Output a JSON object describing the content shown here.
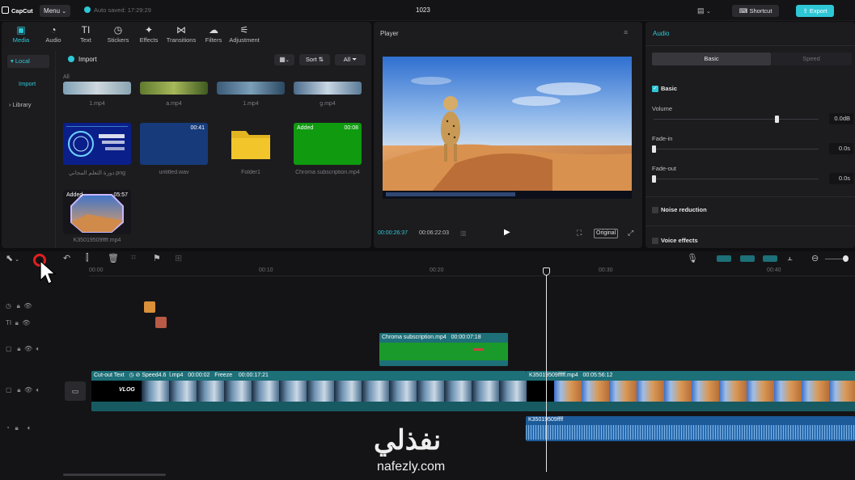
{
  "app": {
    "name": "CapCut",
    "menu_label": "Menu",
    "autosave": "Auto saved: 17:29:29",
    "project_title": "1023",
    "shortcut_label": "Shortcut",
    "export_label": "Export"
  },
  "media_tabs": [
    {
      "label": "Media",
      "icon": "media-icon"
    },
    {
      "label": "Audio",
      "icon": "audio-icon"
    },
    {
      "label": "Text",
      "icon": "text-icon"
    },
    {
      "label": "Stickers",
      "icon": "stickers-icon"
    },
    {
      "label": "Effects",
      "icon": "effects-icon"
    },
    {
      "label": "Transitions",
      "icon": "transitions-icon"
    },
    {
      "label": "Filters",
      "icon": "filters-icon"
    },
    {
      "label": "Adjustment",
      "icon": "adjustment-icon"
    }
  ],
  "sidebar": {
    "local": "Local",
    "import": "Import",
    "library": "Library"
  },
  "media_panel": {
    "import_label": "Import",
    "sort_label": "Sort",
    "all_label": "All",
    "section_label": "All",
    "row1": [
      {
        "name": "1.mp4"
      },
      {
        "name": "a.mp4"
      },
      {
        "name": "1.mp4"
      },
      {
        "name": "g.mp4"
      }
    ],
    "row2": [
      {
        "name": "دورة التعلم المجاني.png"
      },
      {
        "name": "untitled.wav",
        "duration": "00:41"
      },
      {
        "name": "Folder1"
      },
      {
        "name": "Chroma subscription.mp4",
        "duration": "00:08",
        "badge": "Added"
      }
    ],
    "row3": [
      {
        "name": "K35019509ffff.mp4",
        "duration": "05:57",
        "badge": "Added"
      }
    ]
  },
  "player": {
    "title": "Player",
    "current_time": "00:00:26:37",
    "total_time": "00:06:22:03",
    "original_label": "Original"
  },
  "inspector": {
    "title": "Audio",
    "tab_basic": "Basic",
    "tab_speed": "Speed",
    "basic_label": "Basic",
    "volume_label": "Volume",
    "volume_value": "0.0dB",
    "fadein_label": "Fade-in",
    "fadein_value": "0.0s",
    "fadeout_label": "Fade-out",
    "fadeout_value": "0.0s",
    "noise_label": "Noise reduction",
    "voice_label": "Voice effects"
  },
  "timeline": {
    "ruler": [
      "00:00",
      "00:10",
      "00:20",
      "00:30",
      "00:40"
    ],
    "chroma_clip": {
      "name": "Chroma subscription.mp4",
      "duration": "00:00:07:18"
    },
    "main_clip": {
      "cutout": "Cut-out Text",
      "speed": "Speed4.6",
      "file": "l.mp4",
      "time1": "00:00:02",
      "freeze": "Freeze",
      "time2": "00:00:17:21",
      "vlog": "VLOG"
    },
    "second_clip": {
      "name": "K35019509fffff.mp4",
      "duration": "00:05:56:12"
    },
    "audio_clip": {
      "name": "K35019509ffff"
    }
  },
  "watermark": {
    "arabic": "نفذلي",
    "latin": "nafezly.com"
  },
  "colors": {
    "accent": "#2ec7d6",
    "export": "#2ec7d6",
    "clip_green": "#1f9a2f",
    "clip_teal": "#1d6f78",
    "audio_blue": "#1c5a9a",
    "record_red": "#e02020"
  }
}
